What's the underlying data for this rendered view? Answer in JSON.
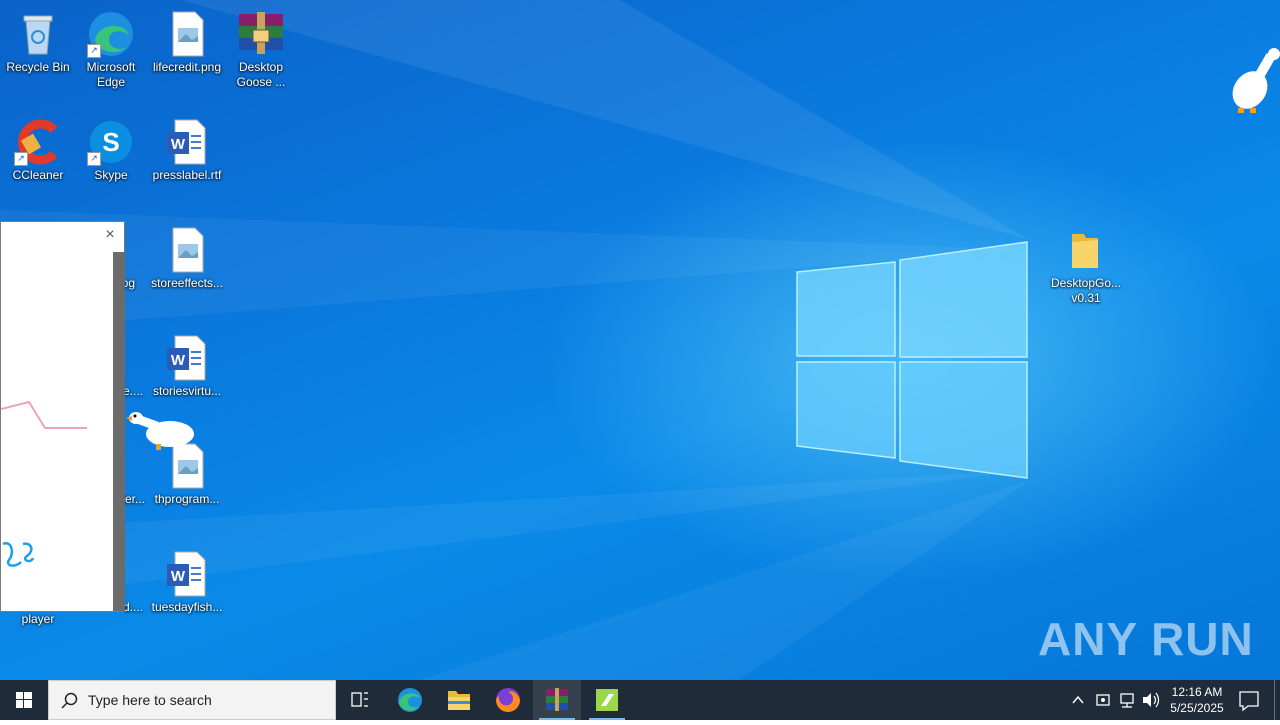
{
  "desktop": {
    "icons": [
      {
        "label": "Recycle Bin"
      },
      {
        "label": "Microsoft Edge"
      },
      {
        "label": "lifecredit.png"
      },
      {
        "label": "Desktop Goose ..."
      },
      {
        "label": "CCleaner"
      },
      {
        "label": "Skype"
      },
      {
        "label": "presslabel.rtf"
      },
      {
        "label": ".jpg"
      },
      {
        "label": "storeeffects..."
      },
      {
        "label": "e...."
      },
      {
        "label": "storiesvirtu..."
      },
      {
        "label": "der..."
      },
      {
        "label": "thprogram..."
      },
      {
        "label": "d...."
      },
      {
        "label": "tuesdayfish..."
      },
      {
        "label": "player"
      },
      {
        "label": "DesktopGo... v0.31"
      }
    ]
  },
  "watermark": "ANY RUN",
  "popup": {
    "close_symbol": "×"
  },
  "taskbar": {
    "search_placeholder": "Type here to search",
    "apps": [
      "task-view",
      "edge",
      "file-explorer",
      "firefox",
      "winrar",
      "desktop-goose"
    ],
    "clock_time": "12:16 AM",
    "clock_date": "5/25/2025"
  }
}
